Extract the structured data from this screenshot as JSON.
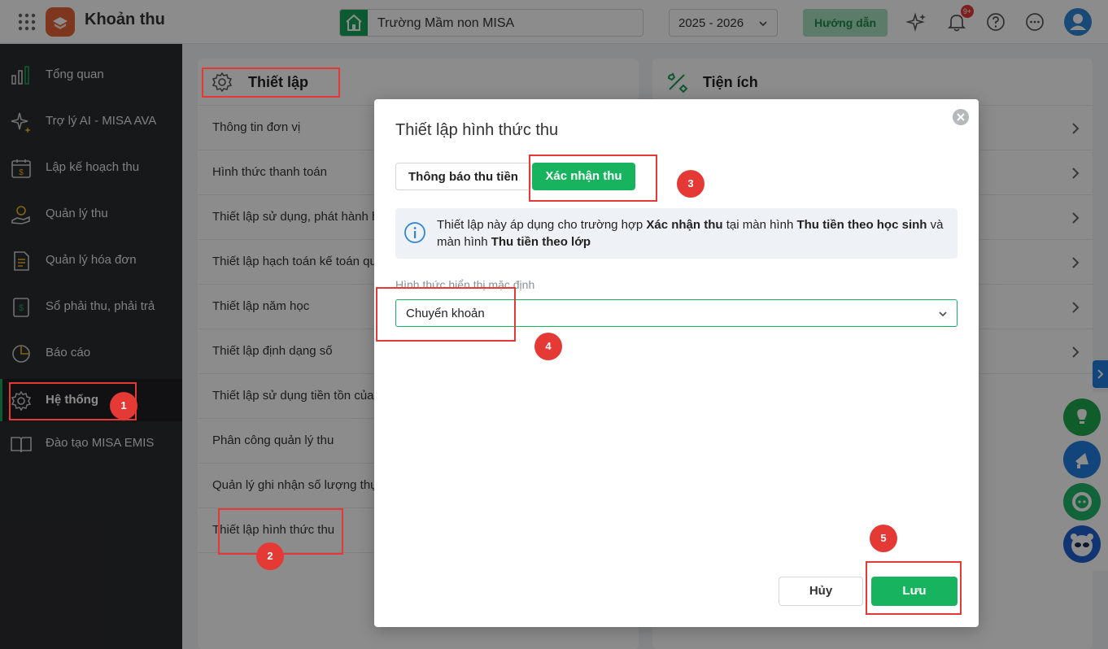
{
  "app": {
    "title": "Khoản thu"
  },
  "header": {
    "school": "Trường Mầm non MISA",
    "year": "2025 - 2026",
    "guide_label": "Hướng dẫn",
    "notification_badge": "9+"
  },
  "sidebar": {
    "items": [
      {
        "label": "Tổng quan",
        "icon": "bar-chart-icon"
      },
      {
        "label": "Trợ lý AI - MISA AVA",
        "icon": "sparkle-icon"
      },
      {
        "label": "Lập kế hoạch thu",
        "icon": "calendar-money-icon"
      },
      {
        "label": "Quản lý thu",
        "icon": "hand-coin-icon"
      },
      {
        "label": "Quản lý hóa đơn",
        "icon": "invoice-icon"
      },
      {
        "label": "Sổ phải thu, phải trả",
        "icon": "ledger-icon"
      },
      {
        "label": "Báo cáo",
        "icon": "pie-chart-icon"
      },
      {
        "label": "Hệ thống",
        "icon": "gear-icon",
        "active": true
      },
      {
        "label": "Đào tạo MISA EMIS",
        "icon": "book-icon"
      }
    ]
  },
  "settings_panel": {
    "title": "Thiết lập",
    "items": [
      "Thông tin đơn vị",
      "Hình thức thanh toán",
      "Thiết lập sử dụng, phát hành h",
      "Thiết lập hạch toán kế toán qu",
      "Thiết lập năm học",
      "Thiết lập định dạng số",
      "Thiết lập sử dụng tiền tồn của",
      "Phân công quản lý thu",
      "Quản lý ghi nhận số lượng thụ",
      "Thiết lập hình thức thu"
    ]
  },
  "utilities_panel": {
    "title": "Tiện ích"
  },
  "modal": {
    "title": "Thiết lập hình thức thu",
    "tabs": [
      "Thông báo thu tiền",
      "Xác nhận thu"
    ],
    "active_tab": "Xác nhận thu",
    "info": {
      "p1": "Thiết lập này áp dụng cho trường hợp ",
      "b1": "Xác nhận thu",
      "p2": " tại màn hình ",
      "b2": "Thu tiền theo học sinh",
      "p3": " và màn hình ",
      "b3": "Thu tiền theo lớp"
    },
    "field_label": "Hình thức hiển thị mặc định",
    "field_value": "Chuyển khoản",
    "cancel_label": "Hủy",
    "save_label": "Lưu"
  },
  "annotations": [
    "1",
    "2",
    "3",
    "4",
    "5"
  ],
  "colors": {
    "primary": "#17b35f",
    "annotation": "#e53935",
    "sidebar_bg": "#2b2c30"
  }
}
